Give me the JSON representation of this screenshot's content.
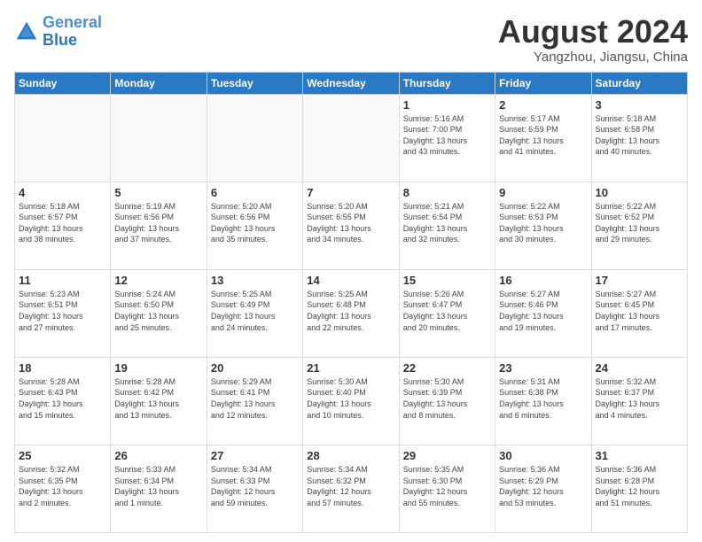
{
  "header": {
    "logo_line1": "General",
    "logo_line2": "Blue",
    "month_year": "August 2024",
    "location": "Yangzhou, Jiangsu, China"
  },
  "weekdays": [
    "Sunday",
    "Monday",
    "Tuesday",
    "Wednesday",
    "Thursday",
    "Friday",
    "Saturday"
  ],
  "weeks": [
    [
      {
        "day": "",
        "info": ""
      },
      {
        "day": "",
        "info": ""
      },
      {
        "day": "",
        "info": ""
      },
      {
        "day": "",
        "info": ""
      },
      {
        "day": "1",
        "info": "Sunrise: 5:16 AM\nSunset: 7:00 PM\nDaylight: 13 hours\nand 43 minutes."
      },
      {
        "day": "2",
        "info": "Sunrise: 5:17 AM\nSunset: 6:59 PM\nDaylight: 13 hours\nand 41 minutes."
      },
      {
        "day": "3",
        "info": "Sunrise: 5:18 AM\nSunset: 6:58 PM\nDaylight: 13 hours\nand 40 minutes."
      }
    ],
    [
      {
        "day": "4",
        "info": "Sunrise: 5:18 AM\nSunset: 6:57 PM\nDaylight: 13 hours\nand 38 minutes."
      },
      {
        "day": "5",
        "info": "Sunrise: 5:19 AM\nSunset: 6:56 PM\nDaylight: 13 hours\nand 37 minutes."
      },
      {
        "day": "6",
        "info": "Sunrise: 5:20 AM\nSunset: 6:56 PM\nDaylight: 13 hours\nand 35 minutes."
      },
      {
        "day": "7",
        "info": "Sunrise: 5:20 AM\nSunset: 6:55 PM\nDaylight: 13 hours\nand 34 minutes."
      },
      {
        "day": "8",
        "info": "Sunrise: 5:21 AM\nSunset: 6:54 PM\nDaylight: 13 hours\nand 32 minutes."
      },
      {
        "day": "9",
        "info": "Sunrise: 5:22 AM\nSunset: 6:53 PM\nDaylight: 13 hours\nand 30 minutes."
      },
      {
        "day": "10",
        "info": "Sunrise: 5:22 AM\nSunset: 6:52 PM\nDaylight: 13 hours\nand 29 minutes."
      }
    ],
    [
      {
        "day": "11",
        "info": "Sunrise: 5:23 AM\nSunset: 6:51 PM\nDaylight: 13 hours\nand 27 minutes."
      },
      {
        "day": "12",
        "info": "Sunrise: 5:24 AM\nSunset: 6:50 PM\nDaylight: 13 hours\nand 25 minutes."
      },
      {
        "day": "13",
        "info": "Sunrise: 5:25 AM\nSunset: 6:49 PM\nDaylight: 13 hours\nand 24 minutes."
      },
      {
        "day": "14",
        "info": "Sunrise: 5:25 AM\nSunset: 6:48 PM\nDaylight: 13 hours\nand 22 minutes."
      },
      {
        "day": "15",
        "info": "Sunrise: 5:26 AM\nSunset: 6:47 PM\nDaylight: 13 hours\nand 20 minutes."
      },
      {
        "day": "16",
        "info": "Sunrise: 5:27 AM\nSunset: 6:46 PM\nDaylight: 13 hours\nand 19 minutes."
      },
      {
        "day": "17",
        "info": "Sunrise: 5:27 AM\nSunset: 6:45 PM\nDaylight: 13 hours\nand 17 minutes."
      }
    ],
    [
      {
        "day": "18",
        "info": "Sunrise: 5:28 AM\nSunset: 6:43 PM\nDaylight: 13 hours\nand 15 minutes."
      },
      {
        "day": "19",
        "info": "Sunrise: 5:28 AM\nSunset: 6:42 PM\nDaylight: 13 hours\nand 13 minutes."
      },
      {
        "day": "20",
        "info": "Sunrise: 5:29 AM\nSunset: 6:41 PM\nDaylight: 13 hours\nand 12 minutes."
      },
      {
        "day": "21",
        "info": "Sunrise: 5:30 AM\nSunset: 6:40 PM\nDaylight: 13 hours\nand 10 minutes."
      },
      {
        "day": "22",
        "info": "Sunrise: 5:30 AM\nSunset: 6:39 PM\nDaylight: 13 hours\nand 8 minutes."
      },
      {
        "day": "23",
        "info": "Sunrise: 5:31 AM\nSunset: 6:38 PM\nDaylight: 13 hours\nand 6 minutes."
      },
      {
        "day": "24",
        "info": "Sunrise: 5:32 AM\nSunset: 6:37 PM\nDaylight: 13 hours\nand 4 minutes."
      }
    ],
    [
      {
        "day": "25",
        "info": "Sunrise: 5:32 AM\nSunset: 6:35 PM\nDaylight: 13 hours\nand 2 minutes."
      },
      {
        "day": "26",
        "info": "Sunrise: 5:33 AM\nSunset: 6:34 PM\nDaylight: 13 hours\nand 1 minute."
      },
      {
        "day": "27",
        "info": "Sunrise: 5:34 AM\nSunset: 6:33 PM\nDaylight: 12 hours\nand 59 minutes."
      },
      {
        "day": "28",
        "info": "Sunrise: 5:34 AM\nSunset: 6:32 PM\nDaylight: 12 hours\nand 57 minutes."
      },
      {
        "day": "29",
        "info": "Sunrise: 5:35 AM\nSunset: 6:30 PM\nDaylight: 12 hours\nand 55 minutes."
      },
      {
        "day": "30",
        "info": "Sunrise: 5:36 AM\nSunset: 6:29 PM\nDaylight: 12 hours\nand 53 minutes."
      },
      {
        "day": "31",
        "info": "Sunrise: 5:36 AM\nSunset: 6:28 PM\nDaylight: 12 hours\nand 51 minutes."
      }
    ]
  ]
}
